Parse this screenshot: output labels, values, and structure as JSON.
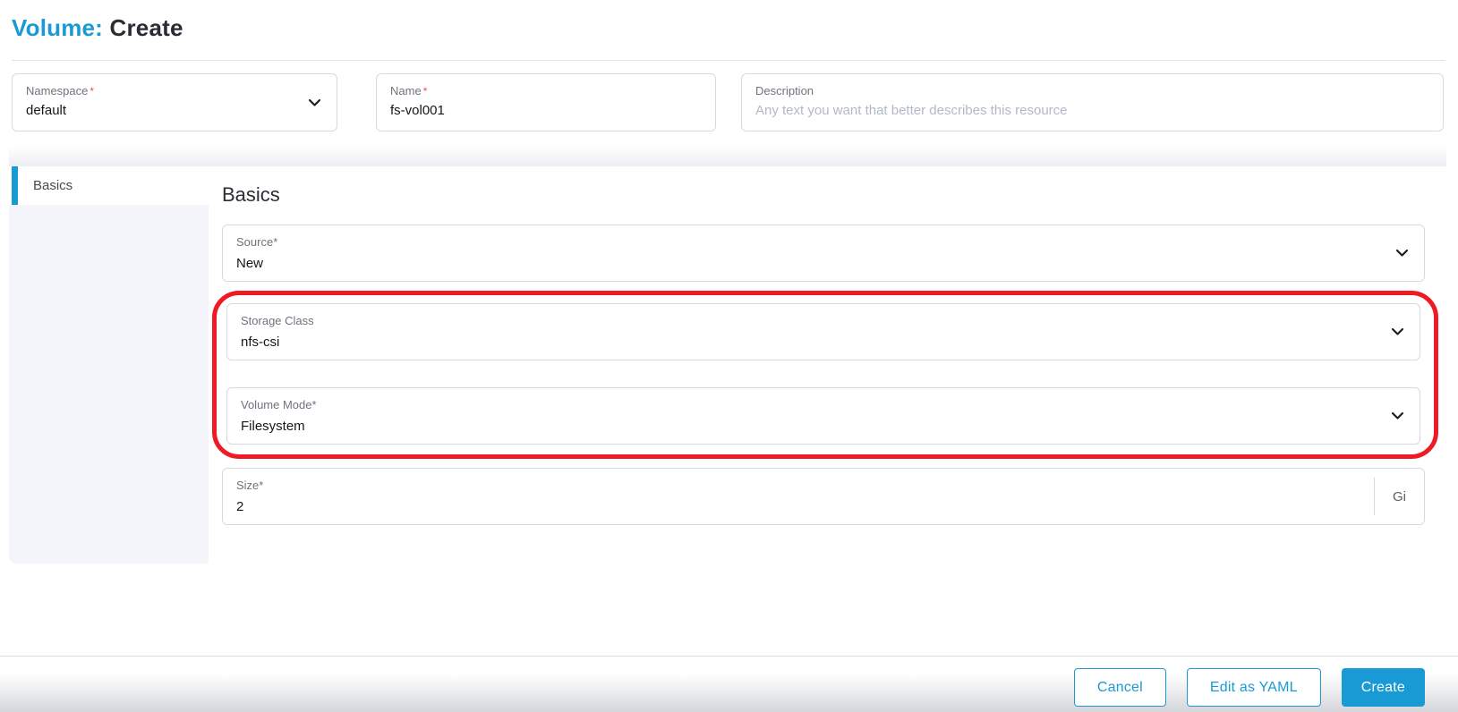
{
  "header": {
    "resource": "Volume:",
    "action": "Create"
  },
  "form": {
    "namespace": {
      "label": "Namespace",
      "required_marker": "*",
      "value": "default"
    },
    "name": {
      "label": "Name",
      "required_marker": "*",
      "value": "fs-vol001"
    },
    "description": {
      "label": "Description",
      "placeholder": "Any text you want that better describes this resource"
    }
  },
  "sidebar": {
    "tabs": [
      {
        "label": "Basics",
        "active": true
      }
    ]
  },
  "basics": {
    "heading": "Basics",
    "source": {
      "label": "Source",
      "required_marker": "*",
      "value": "New"
    },
    "storage_class": {
      "label": "Storage Class",
      "value": "nfs-csi"
    },
    "volume_mode": {
      "label": "Volume Mode",
      "required_marker": "*",
      "value": "Filesystem"
    },
    "size": {
      "label": "Size",
      "required_marker": "*",
      "value": "2",
      "unit": "Gi"
    }
  },
  "annotation": {
    "shape": "red-rounded-rectangle",
    "highlights": [
      "Storage Class",
      "Volume Mode"
    ]
  },
  "footer": {
    "cancel_label": "Cancel",
    "edit_yaml_label": "Edit as YAML",
    "create_label": "Create"
  },
  "colors": {
    "primary": "#1a9ad4",
    "annotation_red": "#ee1b24",
    "required_red": "#f04c4c",
    "sidebar_bg": "#f4f5fa",
    "border": "#d6d9e2"
  }
}
